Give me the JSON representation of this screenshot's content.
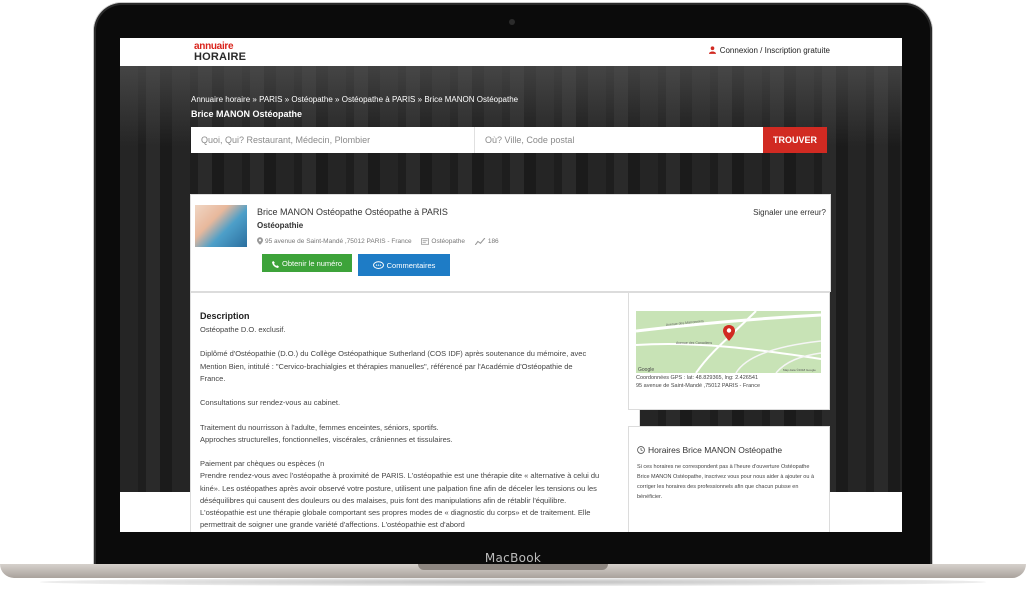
{
  "device": {
    "label": "MacBook"
  },
  "header": {
    "logo_line1": "annuaire",
    "logo_line2": "HORAIRE",
    "login_label": "Connexion / Inscription gratuite"
  },
  "breadcrumb": [
    "Annuaire horaire",
    "PARIS",
    "Ostéopathe",
    "Ostéopathe à PARIS",
    "Brice MANON Ostéopathe"
  ],
  "breadcrumb_sep": "»",
  "page_title": "Brice MANON Ostéopathe",
  "search": {
    "what_placeholder": "Quoi, Qui? Restaurant, Médecin, Plombier",
    "where_placeholder": "Où? Ville, Code postal",
    "button_label": "TROUVER"
  },
  "listing": {
    "name": "Brice MANON Ostéopathe Ostéopathe à PARIS",
    "category": "Ostéopathie",
    "address": "95 avenue de Saint-Mandé ,75012 PARIS - France",
    "tag": "Ostéopathe",
    "views": "186",
    "phone_button": "Obtenir le numéro",
    "comments_button": "Commentaires",
    "report_link": "Signaler une erreur?"
  },
  "description": {
    "title": "Description",
    "paragraphs": [
      "Ostéopathe D.O. exclusif.",
      "Diplômé d'Ostéopathie (D.O.) du Collège Ostéopathique Sutherland (COS IDF) après soutenance du mémoire, avec Mention Bien, intitulé : \"Cervico-brachialgies et thérapies manuelles\", référencé par l'Académie d'Ostéopathie de France.",
      "Consultations sur rendez-vous au cabinet.",
      "Traitement du nourrisson à l'adulte, femmes enceintes, séniors, sportifs.\nApproches structurelles, fonctionnelles, viscérales, crâniennes et tissulaires.",
      "Paiement par chèques ou espèces (n\nPrendre rendez-vous avec l'ostéopathe à proximité de PARIS. L'ostéopathie est une thérapie dite « alternative à celui du kiné». Les ostéopathes après avoir observé votre posture, utilisent une palpation fine afin de déceler les tensions ou les déséquilibres qui causent des douleurs ou des malaises, puis font des manipulations afin de rétablir l'équilibre. L'ostéopathie est une thérapie globale comportant ses propres modes de « diagnostic du corps» et de traitement. Elle permettrait de soigner une grande variété d'affections. L'ostéopathie est d'abord"
    ]
  },
  "map": {
    "coords": "Coordonnées GPS : lat: 48.829365, lng: 2.426541",
    "address": "95 avenue de Saint-Mandé ,75012 PARIS - France",
    "google_label": "Google",
    "map_data_label": "Map data ©2018 Google",
    "street1": "Avenue des Marronniers",
    "street2": "Avenue des Canadiens"
  },
  "hours": {
    "title": "Horaires Brice MANON Ostéopathe",
    "text": "Si ces horaires ne correspondent pas à l'heure d'ouverture Ostéopathe Brice MANON Ostéopathe, inscrivez vous pour nous aider à ajouter ou à corriger les horaires des professionnels afin que chacun puisse en bénéficier."
  },
  "colors": {
    "brand_red": "#d12a22",
    "phone_green": "#3da33a",
    "comments_blue": "#1e7cc6"
  }
}
